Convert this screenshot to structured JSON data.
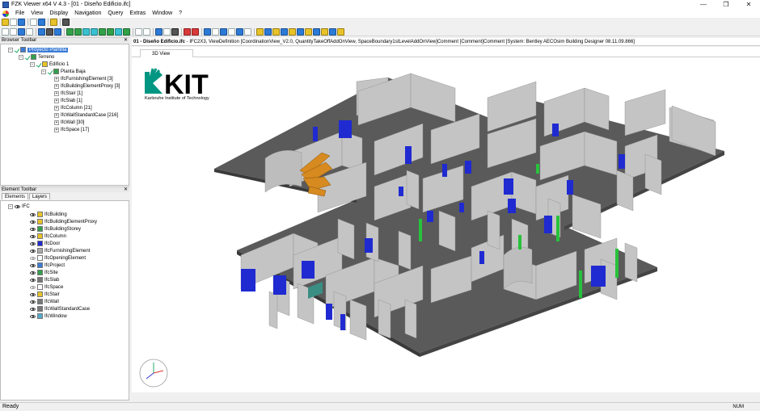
{
  "window": {
    "title": "FZK Viewer x64 V 4.3 - [01 - Diseño Edificio.ifc]"
  },
  "menu": {
    "items": [
      "File",
      "View",
      "Display",
      "Navigation",
      "Query",
      "Extras",
      "Window",
      "?"
    ]
  },
  "browser": {
    "title": "Browser Toolbar",
    "tree": [
      {
        "label": "Proyecto Plantilla",
        "level": 0,
        "selected": true
      },
      {
        "label": "Terreno",
        "level": 1
      },
      {
        "label": "Edificio 1",
        "level": 2
      },
      {
        "label": "Planta Baja",
        "level": 3
      },
      {
        "label": "IfcFurnishingElement [3]",
        "level": 4
      },
      {
        "label": "IfcBuildingElementProxy [3]",
        "level": 4
      },
      {
        "label": "IfcStair [1]",
        "level": 4
      },
      {
        "label": "IfcSlab [1]",
        "level": 4
      },
      {
        "label": "IfcColumn [21]",
        "level": 4
      },
      {
        "label": "IfcWallStandardCase [216]",
        "level": 4
      },
      {
        "label": "IfcWall [30]",
        "level": 4
      },
      {
        "label": "IfcSpace [17]",
        "level": 4
      }
    ]
  },
  "element_toolbar": {
    "title": "Element Toolbar",
    "tabs": [
      "Elements",
      "Layers"
    ],
    "root": "IFC",
    "items": [
      {
        "label": "IfcBuilding",
        "visible": true
      },
      {
        "label": "IfcBuildingElementProxy",
        "visible": true
      },
      {
        "label": "IfcBuildingStorey",
        "visible": true
      },
      {
        "label": "IfcColumn",
        "visible": true
      },
      {
        "label": "IfcDoor",
        "visible": true
      },
      {
        "label": "IfcFurnishingElement",
        "visible": true
      },
      {
        "label": "IfcOpeningElement",
        "visible": false
      },
      {
        "label": "IfcProject",
        "visible": true
      },
      {
        "label": "IfcSite",
        "visible": true
      },
      {
        "label": "IfcSlab",
        "visible": true
      },
      {
        "label": "IfcSpace",
        "visible": false
      },
      {
        "label": "IfcStair",
        "visible": true
      },
      {
        "label": "IfcWall",
        "visible": true
      },
      {
        "label": "IfcWallStandardCase",
        "visible": true
      },
      {
        "label": "IfcWindow",
        "visible": true
      }
    ]
  },
  "view": {
    "header_bold": "01 - Diseño Edificio.ifc",
    "header_rest": " - IFC2X3, ViewDefinition [CoordinationView_V2.0, QuantityTakeOffAddOnView, SpaceBoundary1stLevelAddOnView]Comment [Comment]Comment [System: Bentley AECOsim Building Designer 08.11.09.866]",
    "tab": "3D View"
  },
  "logo": {
    "text": "KIT",
    "subtitle": "Karlsruhe Institute of Technology"
  },
  "status": {
    "left": "Ready",
    "right": "NUM"
  },
  "colors": {
    "floor": "#5a5a5a",
    "wall": "#c4c4c4",
    "door": "#1f2ad1",
    "column": "#27c23b",
    "stair": "#d68a1f",
    "kit_green": "#009682"
  }
}
